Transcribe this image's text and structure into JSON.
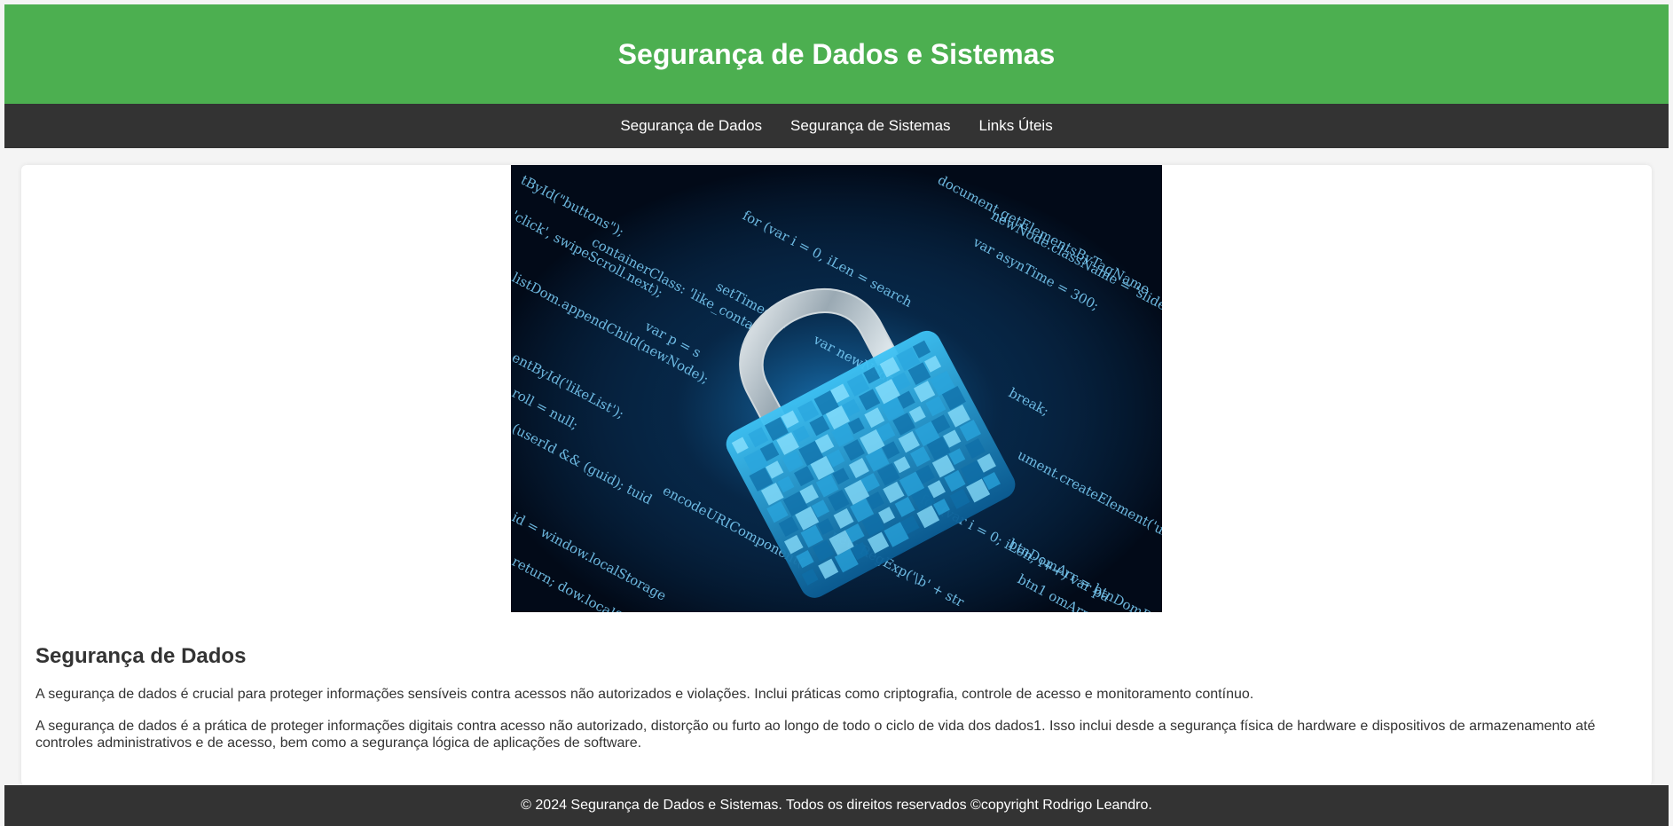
{
  "header": {
    "title": "Segurança de Dados e Sistemas"
  },
  "nav": {
    "items": [
      {
        "label": "Segurança de Dados"
      },
      {
        "label": "Segurança de Sistemas"
      },
      {
        "label": "Links Úteis"
      }
    ]
  },
  "main": {
    "hero_image": {
      "icon": "padlock-icon",
      "code_lines": [
        "tById(\"buttons\");",
        "'click', swipeScroll.next);",
        "containerClass: 'like_contain",
        "for (var i = 0, iLen = search",
        "setTimeout(",
        "var p = s",
        "listDom.appendChild(newNode);",
        "entById('likeList');",
        "(userId && (guid); tuid",
        "var asynTime = 300;",
        "document.getElementsByTagName",
        "newNode.className = 'slide",
        "var newNode",
        "break;",
        "ument.createElement('ul');",
        "for (var i = 0; iLen; i++) var pa",
        "btnDomArr = btnDomBo",
        "btn1 omArr = btnDc",
        "new RegExp('\\b' + str",
        "encodeURIComponent(",
        "id = window.localStorage",
        "return; dow.localStor",
        "roll = null;"
      ],
      "colors": {
        "background": "#020a18",
        "code": "#7fd4ff",
        "lock": "#1fa8e0"
      }
    },
    "section_title": "Segurança de Dados",
    "paragraphs": [
      "A segurança de dados é crucial para proteger informações sensíveis contra acessos não autorizados e violações. Inclui práticas como criptografia, controle de acesso e monitoramento contínuo.",
      "A segurança de dados é a prática de proteger informações digitais contra acesso não autorizado, distorção ou furto ao longo de todo o ciclo de vida dos dados1. Isso inclui desde a segurança física de hardware e dispositivos de armazenamento até controles administrativos e de acesso, bem como a segurança lógica de aplicações de software."
    ]
  },
  "footer": {
    "text": "© 2024 Segurança de Dados e Sistemas. Todos os direitos reservados ©copyright Rodrigo Leandro."
  },
  "colors": {
    "header_bg": "#4caf50",
    "nav_bg": "#333333",
    "page_bg": "#f4f4f4",
    "text": "#333333"
  }
}
